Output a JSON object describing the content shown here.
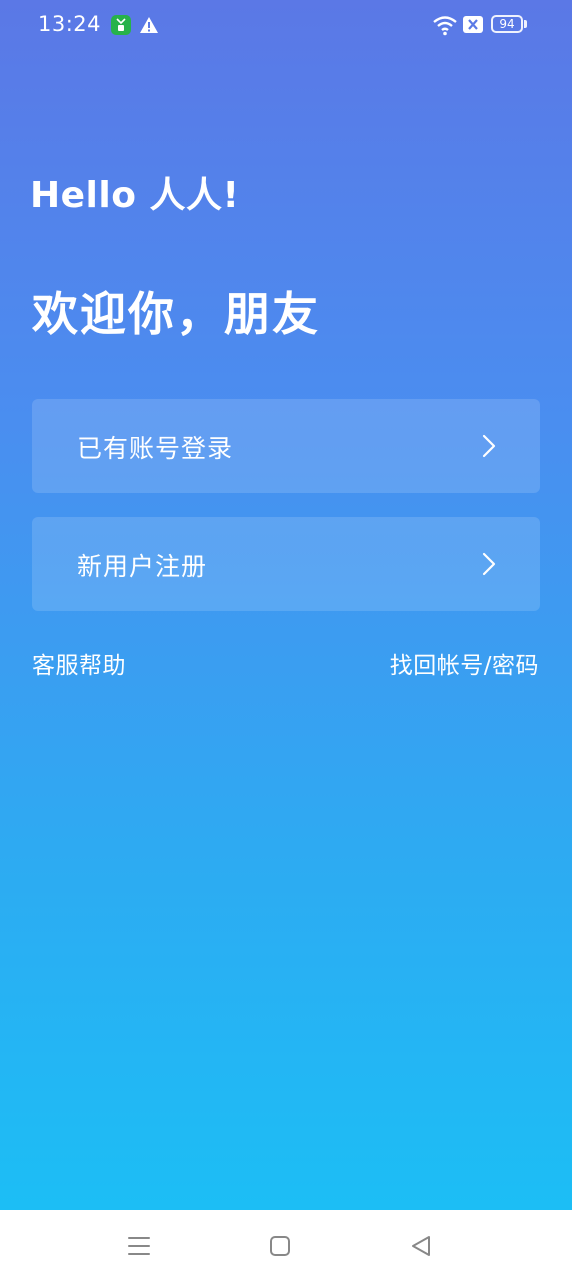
{
  "status_bar": {
    "time": "13:24",
    "battery": "94",
    "icons": [
      "app-notification-icon",
      "warning-icon",
      "wifi-icon",
      "sim-icon",
      "battery-icon"
    ]
  },
  "logo": {
    "text": "Hello 人人!"
  },
  "welcome": {
    "title": "欢迎你，朋友"
  },
  "actions": {
    "login_label": "已有账号登录",
    "register_label": "新用户注册"
  },
  "links": {
    "help": "客服帮助",
    "recover": "找回帐号/密码"
  },
  "nav_bar": {
    "icons": [
      "menu-icon",
      "home-icon",
      "back-icon"
    ]
  },
  "colors": {
    "gradient_top": "#5b78e6",
    "gradient_bottom": "#1cbef5",
    "text": "#ffffff"
  }
}
